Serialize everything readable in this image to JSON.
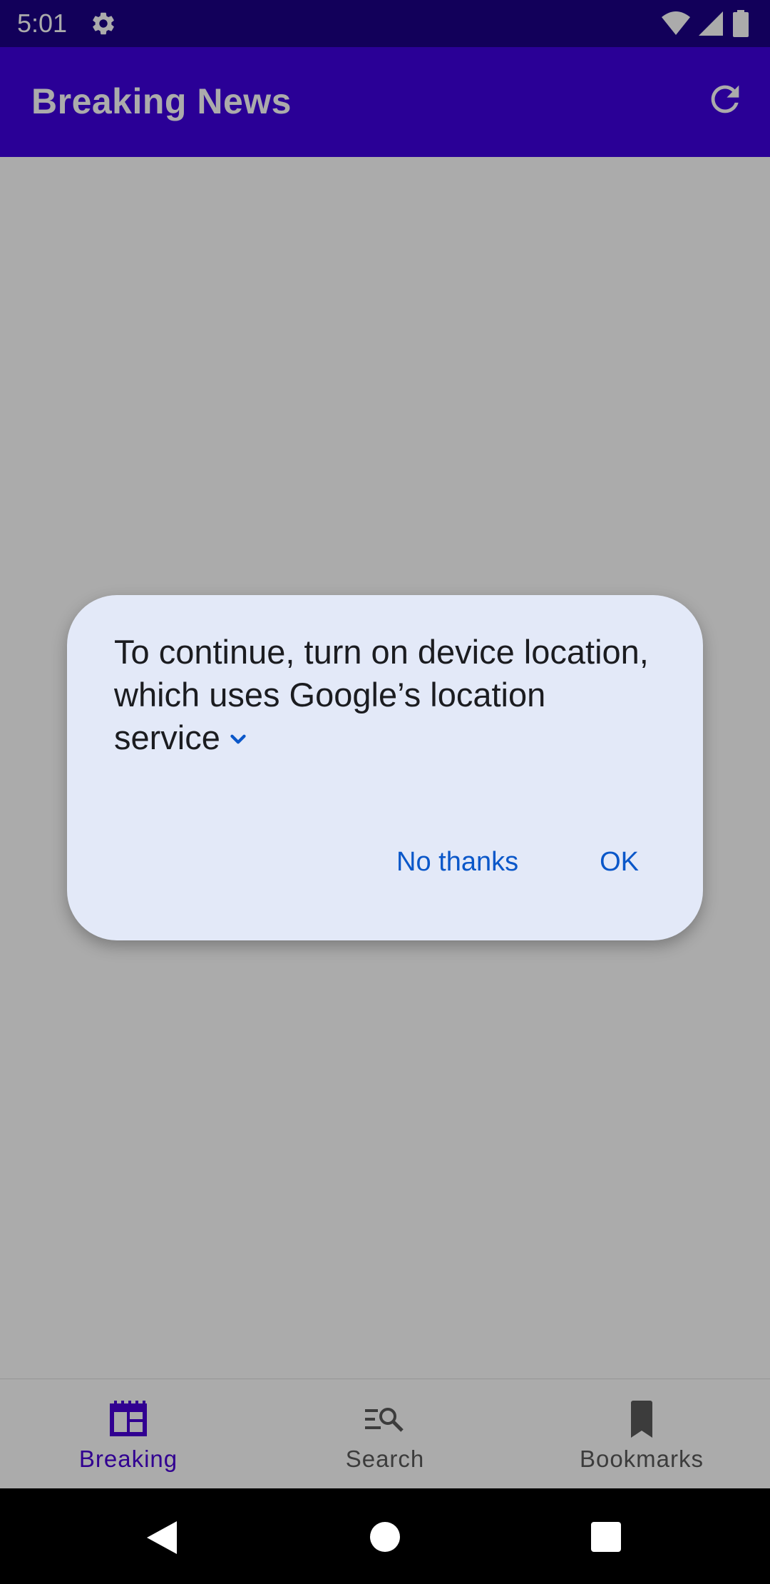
{
  "status_bar": {
    "time": "5:01",
    "icons": [
      "gear-icon",
      "wifi-icon",
      "signal-icon",
      "battery-icon"
    ]
  },
  "app_bar": {
    "title": "Breaking News",
    "refresh_icon": "refresh-icon"
  },
  "bottom_nav": {
    "items": [
      {
        "label": "Breaking",
        "icon": "newspaper-icon",
        "active": true
      },
      {
        "label": "Search",
        "icon": "search-list-icon",
        "active": false
      },
      {
        "label": "Bookmarks",
        "icon": "bookmark-icon",
        "active": false
      }
    ]
  },
  "dialog": {
    "message": "To continue, turn on device location, which uses Google’s location service",
    "expand_icon": "chevron-down-icon",
    "negative_label": "No thanks",
    "positive_label": "OK"
  },
  "system_nav": {
    "icons": [
      "back-icon",
      "home-icon",
      "recents-icon"
    ]
  },
  "colors": {
    "status_bar": "#1b0087",
    "app_bar": "#3f00e0",
    "dialog_bg": "#e3e9f8",
    "dialog_button": "#0a57c9",
    "nav_active": "#4a00d8"
  }
}
